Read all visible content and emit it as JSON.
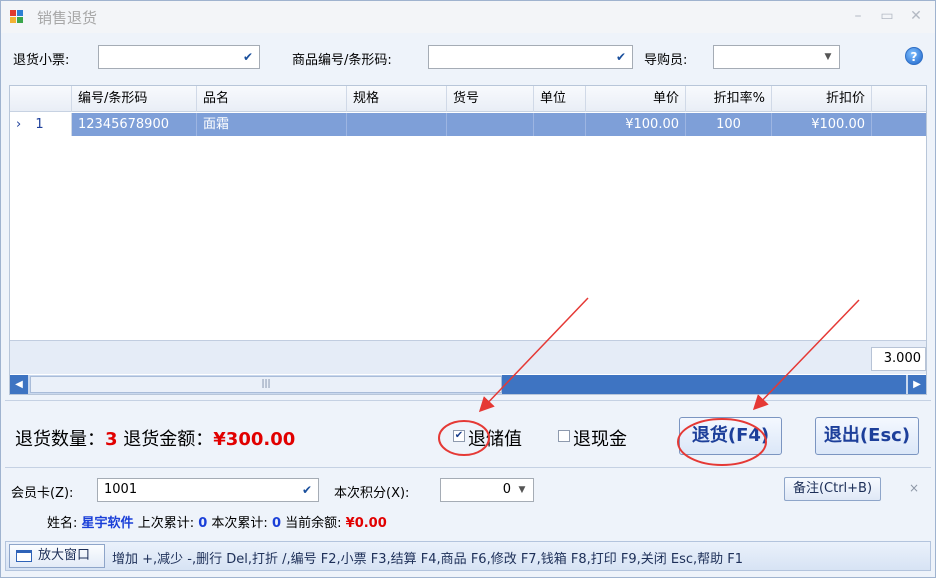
{
  "window": {
    "title": "销售退货",
    "min_glyph": "–",
    "max_glyph": "▭",
    "close_glyph": "✕"
  },
  "filters": {
    "ticket_label": "退货小票:",
    "ticket_value": "",
    "product_label": "商品编号/条形码:",
    "product_value": "",
    "guide_label": "导购员:",
    "guide_value": "",
    "help_glyph": "?"
  },
  "grid": {
    "columns": [
      "编号/条形码",
      "品名",
      "规格",
      "货号",
      "单位",
      "单价",
      "折扣率%",
      "折扣价"
    ],
    "rows": [
      {
        "indicator": "›",
        "index": "1",
        "code": "12345678900",
        "name": "面霜",
        "spec": "",
        "item_no": "",
        "unit": "",
        "price": "¥100.00",
        "discount_rate": "100",
        "discount_price": "¥100.00"
      }
    ],
    "sum_value": "3.000",
    "scroll_left": "◀",
    "scroll_right": "▶",
    "thumb_grip": "|||"
  },
  "summary": {
    "qty_label": "退货数量：",
    "qty_value": "3",
    "amount_label": "退货金额：",
    "amount_value": "¥300.00",
    "stored_value_label": "退储值",
    "stored_value_checked": true,
    "cash_label": "退现金",
    "cash_checked": false,
    "return_button": "退货(F4)",
    "exit_button": "退出(Esc)"
  },
  "member": {
    "card_label": "会员卡(Z):",
    "card_value": "1001",
    "points_label": "本次积分(X):",
    "points_value": "0",
    "note_button": "备注(Ctrl+B)",
    "close_glyph": "×",
    "name_label": "姓名:",
    "name_value": "星宇软件",
    "last_total_label": "上次累计:",
    "last_total_value": "0",
    "this_total_label": "本次累计:",
    "this_total_value": "0",
    "balance_label": "当前余额:",
    "balance_value": "¥0.00"
  },
  "statusbar": {
    "enlarge_button": "放大窗口",
    "hotkeys": "增加 +,减少 -,删行 Del,打折 /,编号 F2,小票 F3,结算 F4,商品 F6,修改 F7,钱箱 F8,打印 F9,关闭 Esc,帮助 F1"
  },
  "colors": {
    "selected_row": "#7e9fd8",
    "accent_blue": "#1d3f9a",
    "emphasis_red": "#e10000",
    "annotation_red": "#e53935"
  }
}
